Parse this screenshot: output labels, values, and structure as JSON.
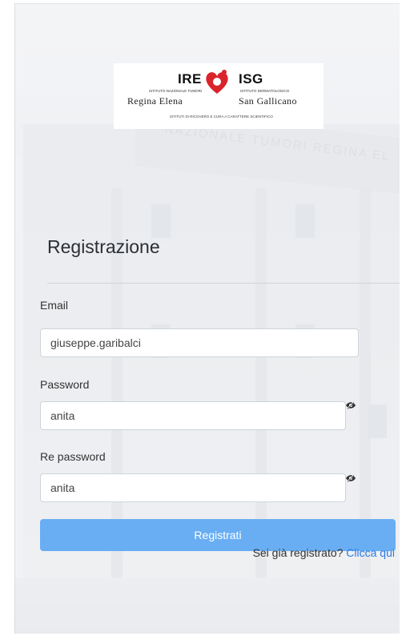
{
  "logo": {
    "ire": "IRE",
    "ire_sub": "ISTITUTO NAZIONALE TUMORI",
    "ire_name": "Regina Elena",
    "isg": "ISG",
    "isg_sub": "ISTITUTO DERMATOLOGICO",
    "isg_name": "San Gallicano",
    "footer": "ISTITUTI DI RICOVERO E CURA A CARATTERE SCIENTIFICO"
  },
  "background": {
    "facade_text": "NAZIONALE TUMORI REGINA EL"
  },
  "form": {
    "title": "Registrazione",
    "email_label": "Email",
    "email_value": "giuseppe.garibalci",
    "password_label": "Password",
    "password_value": "anita",
    "repassword_label": "Re password",
    "repassword_value": "anita",
    "submit_label": "Registrati",
    "login_prompt": "Sei già registrato?",
    "login_link": "Clicca qui"
  },
  "icons": {
    "password_toggle": "eye-slash-icon"
  },
  "colors": {
    "button": "#69aef3",
    "link": "#2c7be5"
  }
}
